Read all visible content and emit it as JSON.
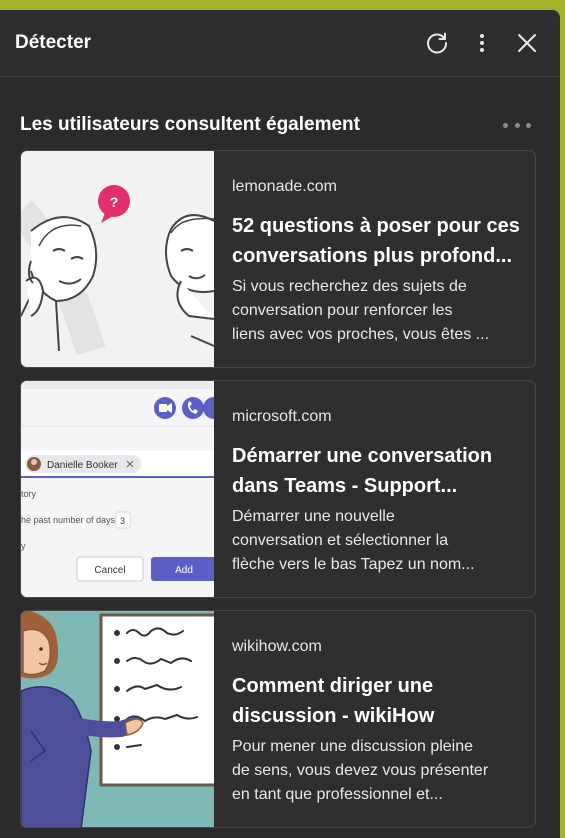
{
  "header": {
    "title": "Détecter",
    "icons": [
      "refresh-icon",
      "more-vertical-icon",
      "close-icon"
    ]
  },
  "section": {
    "title": "Les utilisateurs consultent également"
  },
  "cards": [
    {
      "source": "lemonade.com",
      "title": "52 questions à poser pour ces\nconversations plus profond...",
      "description": "Si vous recherchez des sujets de\nconversation pour renforcer les\nliens avec vos proches, vous êtes ..."
    },
    {
      "source": "microsoft.com",
      "title": "Démarrer une conversation\ndans Teams - Support...",
      "description": "Démarrer une nouvelle\nconversation et sélectionner la\nflèche vers le bas Tapez un nom...",
      "thumbnail": {
        "chip_name": "Danielle Booker",
        "text_1": "tory",
        "text_2": "he past number of days:",
        "days_value": "3",
        "text_3": "y",
        "cancel_label": "Cancel",
        "add_label": "Add"
      }
    },
    {
      "source": "wikihow.com",
      "title": "Comment diriger une\ndiscussion - wikiHow",
      "description": "Pour mener une discussion pleine\nde sens, vous devez vous présenter\nen tant que professionnel et..."
    }
  ],
  "colors": {
    "page_background": "#a7b22c",
    "panel_background": "#2b2b2b",
    "card_background": "#2f2f2f",
    "teams_purple": "#5b5fc7",
    "help_bubble": "#e0306f"
  }
}
